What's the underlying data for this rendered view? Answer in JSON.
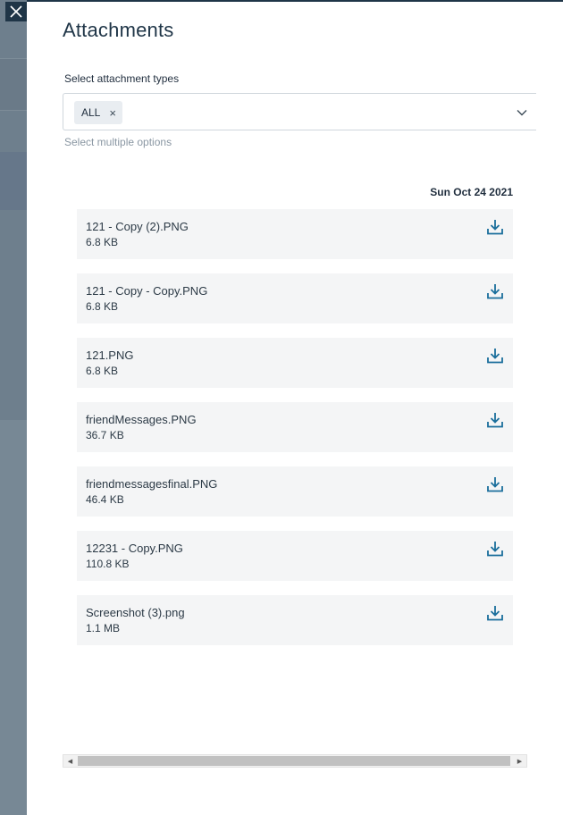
{
  "panel": {
    "title": "Attachments"
  },
  "filter": {
    "label": "Select attachment types",
    "selected_chip": "ALL",
    "chip_remove": "×",
    "hint": "Select multiple options"
  },
  "group": {
    "date": "Sun Oct 24 2021"
  },
  "attachments": [
    {
      "name": "121 - Copy (2).PNG",
      "size": "6.8 KB"
    },
    {
      "name": "121 - Copy - Copy.PNG",
      "size": "6.8 KB"
    },
    {
      "name": "121.PNG",
      "size": "6.8 KB"
    },
    {
      "name": "friendMessages.PNG",
      "size": "36.7 KB"
    },
    {
      "name": "friendmessagesfinal.PNG",
      "size": "46.4 KB"
    },
    {
      "name": "12231 - Copy.PNG",
      "size": "110.8 KB"
    },
    {
      "name": "Screenshot (3).png",
      "size": "1.1 MB"
    }
  ],
  "colors": {
    "accent": "#1a6e9c",
    "header_dark": "#1f3547"
  },
  "icons": {
    "close": "close-icon",
    "dropdown": "chevron-down-icon",
    "download": "download-icon"
  }
}
